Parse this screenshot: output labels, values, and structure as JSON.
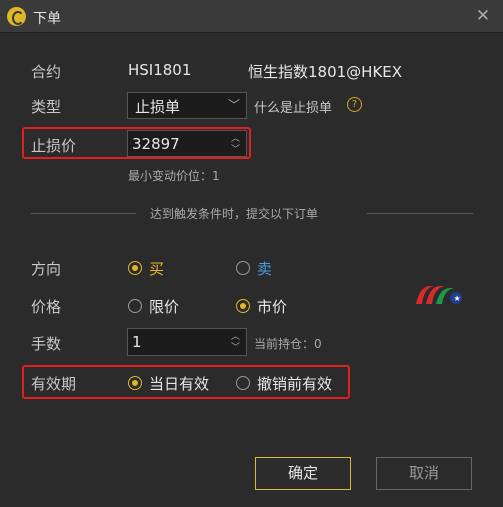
{
  "window": {
    "title": "下单",
    "close_glyph": "✕"
  },
  "contract": {
    "label": "合约",
    "code": "HSI1801",
    "name": "恒生指数1801@HKEX"
  },
  "order_type": {
    "label": "类型",
    "selected": "止损单",
    "help_text": "什么是止损单",
    "help_glyph": "?"
  },
  "stop_price": {
    "label": "止损价",
    "value": "32897",
    "min_tick": "最小变动价位：1"
  },
  "divider": {
    "text": "达到触发条件时，提交以下订单"
  },
  "direction": {
    "label": "方向",
    "options": [
      {
        "label": "买",
        "checked": true,
        "color": "#e8b82e"
      },
      {
        "label": "卖",
        "checked": false,
        "color": "#4a9be0"
      }
    ]
  },
  "price": {
    "label": "价格",
    "options": [
      {
        "label": "限价",
        "checked": false
      },
      {
        "label": "市价",
        "checked": true
      }
    ]
  },
  "quantity": {
    "label": "手数",
    "value": "1",
    "position_text": "当前持仓：0"
  },
  "validity": {
    "label": "有效期",
    "options": [
      {
        "label": "当日有效",
        "checked": true
      },
      {
        "label": "撤销前有效",
        "checked": false
      }
    ]
  },
  "buttons": {
    "confirm": "确定",
    "cancel": "取消"
  },
  "colors": {
    "accent": "#e0b72a",
    "highlight": "#e02020",
    "sell": "#4a9be0"
  }
}
